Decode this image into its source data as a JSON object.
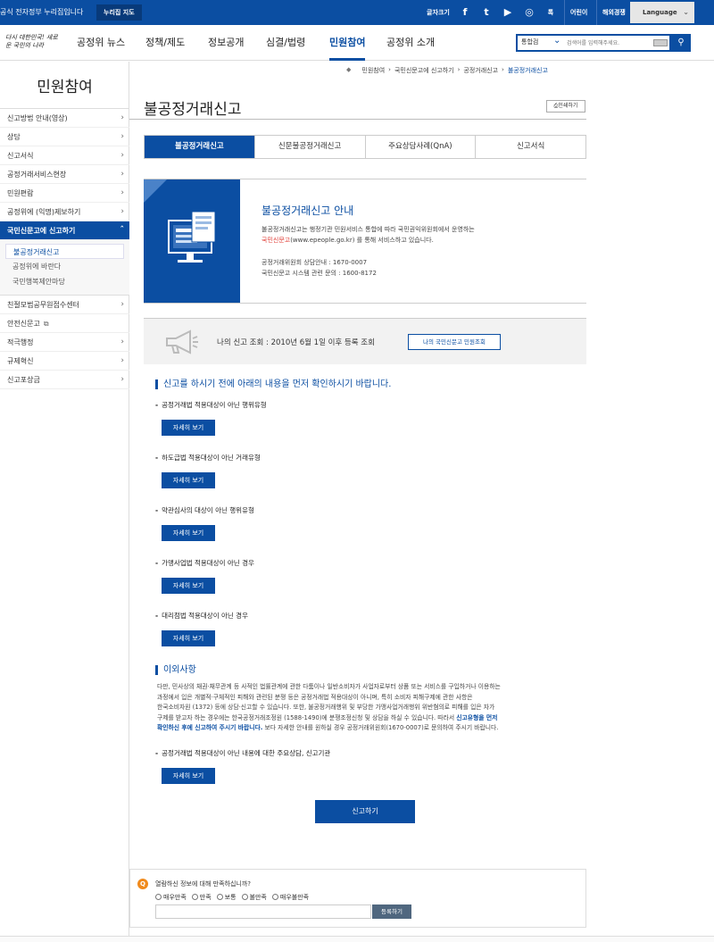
{
  "topbar": {
    "gov_text": "공식 전자정부 누리집입니다",
    "gov_btn": "누리집 지도",
    "font_size": "글자크기",
    "sns": [
      "f",
      "t",
      "▶",
      "◎",
      "톡"
    ],
    "kids": "어린이",
    "abroad": "해외경쟁",
    "language": "Language"
  },
  "header": {
    "logo": "다시 대한민국! 새로운 국민의 나라",
    "nav": [
      "공정위 뉴스",
      "정책/제도",
      "정보공개",
      "심결/법령",
      "민원참여",
      "공정위 소개"
    ],
    "search_select": "통합검",
    "search_placeholder": "검색어를 입력해주세요."
  },
  "lnb": {
    "title": "민원참여",
    "items": [
      "신고방법 안내(영상)",
      "상담",
      "신고서식",
      "공정거래서비스현장",
      "민원편람",
      "공정위에 (익명)제보하기",
      "국민신문고에 신고하기"
    ],
    "sub": [
      "불공정거래신고",
      "공정위에 바란다",
      "국민행복제안마당"
    ],
    "items2": [
      "친절모범공무원접수센터",
      "안전신문고",
      "적극행정",
      "규제혁신",
      "신고포상금"
    ]
  },
  "breadcrumb": [
    "민원참여",
    "국민신문고에 신고하기",
    "공정거래신고",
    "불공정거래신고"
  ],
  "page": {
    "title": "불공정거래신고",
    "print": "인쇄하기",
    "tabs": [
      "불공정거래신고",
      "신문불공정거래신고",
      "주요상담사례(QnA)",
      "신고서식"
    ]
  },
  "info": {
    "heading": "불공정거래신고 안내",
    "line1": "불공정거래신고는 행정기관 민원서비스 통합에 따라 국민권익위원회에서 운영하는",
    "line2_red": "국민신문고",
    "line2_rest": "(www.epeople.go.kr) 를 통해 서비스하고 있습니다.",
    "line3": "공정거래위원회 상담안내 : 1670-0007",
    "line4": "국민신문고 시스템 관련 문의 : 1600-8172"
  },
  "lookup": {
    "text": "나의 신고 조회 : 2010년 6월 1일 이후 등록 조회",
    "button": "나의 국민신문고 민원조회"
  },
  "section1": {
    "title": "신고를 하시기 전에 아래의 내용을 먼저 확인하시기 바랍니다.",
    "items": [
      "공정거래법 적용대상이 아닌 행위유형",
      "하도급법 적용대상이 아닌 거래유형",
      "약관심사의 대상이 아닌 행위유형",
      "가맹사업법 적용대상이 아닌 경우",
      "대리점법 적용대상이 아닌 경우"
    ],
    "detail": "자세히 보기"
  },
  "section2": {
    "title": "이외사항",
    "p1": "다만, 민사상의 채권·채무관계 등 사적인 법률관계에 관한 다툼이나 일반소비자가 사업자로부터 상품 또는 서비스를 구입하거나 이용하는",
    "p2": "과정에서 입은 개별적·구체적인 피해와 관련된 분쟁 등은 공정거래법 적용대상이 아니며, 특히 소비자 피해구제에 관한 사항은",
    "p3": "한국소비자원 (1372) 등에 상담·신고할 수 있습니다. 또한, 불공정거래행위 및 부당한 가맹사업거래행위 위반혐의로 피해를 입은 자가",
    "p4a": "구제를 받고자 하는 경우에는 한국공정거래조정원 (1588-1490)에 분쟁조정신청 및 상담을 하실 수 있습니다. 따라서 ",
    "p4b": "신고유형을 먼저",
    "p5a": "확인하신 후에 신고하여 주시기 바랍니다.",
    "p5b": " 보다 자세한 안내를 원하실 경우 공정거래위원회(1670-0007)로 문의하여 주시기 바랍니다.",
    "item": "공정거래법 적용대상이 아닌 내용에 대한 주요상담, 신고기관"
  },
  "report_button": "신고하기",
  "survey": {
    "question": "열람하신 정보에 대해 만족하십니까?",
    "options": [
      "매우만족",
      "만족",
      "보통",
      "불만족",
      "매우불만족"
    ],
    "submit": "등록하기"
  }
}
